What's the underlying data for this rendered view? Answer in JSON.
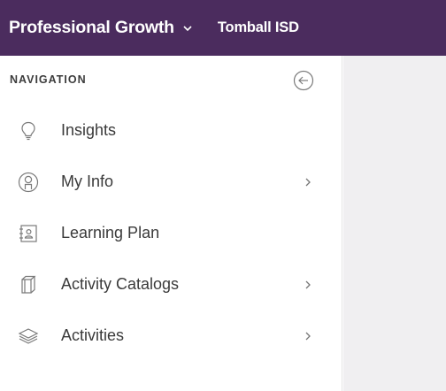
{
  "header": {
    "product_label": "Professional Growth",
    "district_label": "Tomball ISD"
  },
  "colors": {
    "header_bg": "#4b2c5e",
    "sidebar_bg": "#ffffff",
    "content_bg": "#f0eff1",
    "text": "#3a3a3a",
    "icon": "#7a7a7a"
  },
  "sidebar": {
    "title": "NAVIGATION",
    "collapse_icon": "arrow-circle-left-icon",
    "items": [
      {
        "label": "Insights",
        "icon": "lightbulb-icon",
        "has_submenu": false
      },
      {
        "label": "My Info",
        "icon": "user-circle-icon",
        "has_submenu": true
      },
      {
        "label": "Learning Plan",
        "icon": "id-card-icon",
        "has_submenu": false
      },
      {
        "label": "Activity Catalogs",
        "icon": "books-icon",
        "has_submenu": true
      },
      {
        "label": "Activities",
        "icon": "layers-icon",
        "has_submenu": true
      }
    ]
  }
}
